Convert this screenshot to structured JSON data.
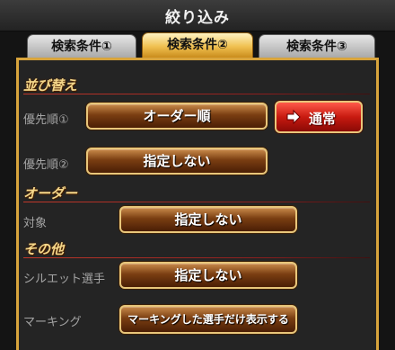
{
  "title": "絞り込み",
  "tabs": [
    "検索条件①",
    "検索条件②",
    "検索条件③"
  ],
  "active_tab": 1,
  "sections": {
    "sort": {
      "heading": "並び替え",
      "priority1": {
        "label": "優先順①",
        "value": "オーダー順"
      },
      "order_button": "通常",
      "priority2": {
        "label": "優先順②",
        "value": "指定しない"
      }
    },
    "order": {
      "heading": "オーダー",
      "target": {
        "label": "対象",
        "value": "指定しない"
      }
    },
    "other": {
      "heading": "その他",
      "silhouette": {
        "label": "シルエット選手",
        "value": "指定しない"
      },
      "marking": {
        "label": "マーキング",
        "value": "マーキングした選手だけ表示する"
      }
    }
  },
  "colors": {
    "accent_gold": "#d8a43c",
    "section_text": "#f4d78a",
    "button_brown": "#7a3e12",
    "button_red": "#c81a10"
  },
  "icons": {
    "order_toggle": "right-arrow-icon"
  }
}
